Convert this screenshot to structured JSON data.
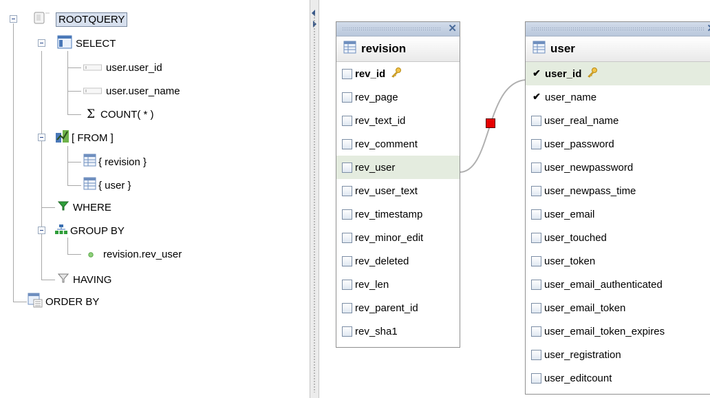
{
  "query_tree": {
    "root": "ROOTQUERY",
    "select": {
      "label": "SELECT",
      "fields": [
        "user.user_id",
        "user.user_name"
      ],
      "aggregate": "COUNT( * )"
    },
    "from": {
      "label": "[ FROM ]",
      "tables": [
        "{ revision }",
        "{ user }"
      ]
    },
    "where": "WHERE",
    "group_by": {
      "label": "GROUP BY",
      "fields": [
        "revision.rev_user"
      ]
    },
    "having": "HAVING",
    "order_by": "ORDER BY"
  },
  "tables": {
    "revision": {
      "name": "revision",
      "columns": [
        "rev_id",
        "rev_page",
        "rev_text_id",
        "rev_comment",
        "rev_user",
        "rev_user_text",
        "rev_timestamp",
        "rev_minor_edit",
        "rev_deleted",
        "rev_len",
        "rev_parent_id",
        "rev_sha1"
      ],
      "primary_key": "rev_id",
      "highlighted": "rev_user"
    },
    "user": {
      "name": "user",
      "columns": [
        "user_id",
        "user_name",
        "user_real_name",
        "user_password",
        "user_newpassword",
        "user_newpass_time",
        "user_email",
        "user_touched",
        "user_token",
        "user_email_authenticated",
        "user_email_token",
        "user_email_token_expires",
        "user_registration",
        "user_editcount"
      ],
      "primary_key": "user_id",
      "checked": [
        "user_id",
        "user_name"
      ],
      "highlighted": "user_id"
    }
  },
  "icons": {
    "close": "close-icon",
    "key": "key-icon",
    "table": "table-icon"
  },
  "colors": {
    "accent": "#d7e0ee",
    "highlight_row": "#e4ecdf",
    "relation_marker": "#e60000",
    "relation_line": "#b0b0b0",
    "header_blue": "#b9c8dc"
  }
}
